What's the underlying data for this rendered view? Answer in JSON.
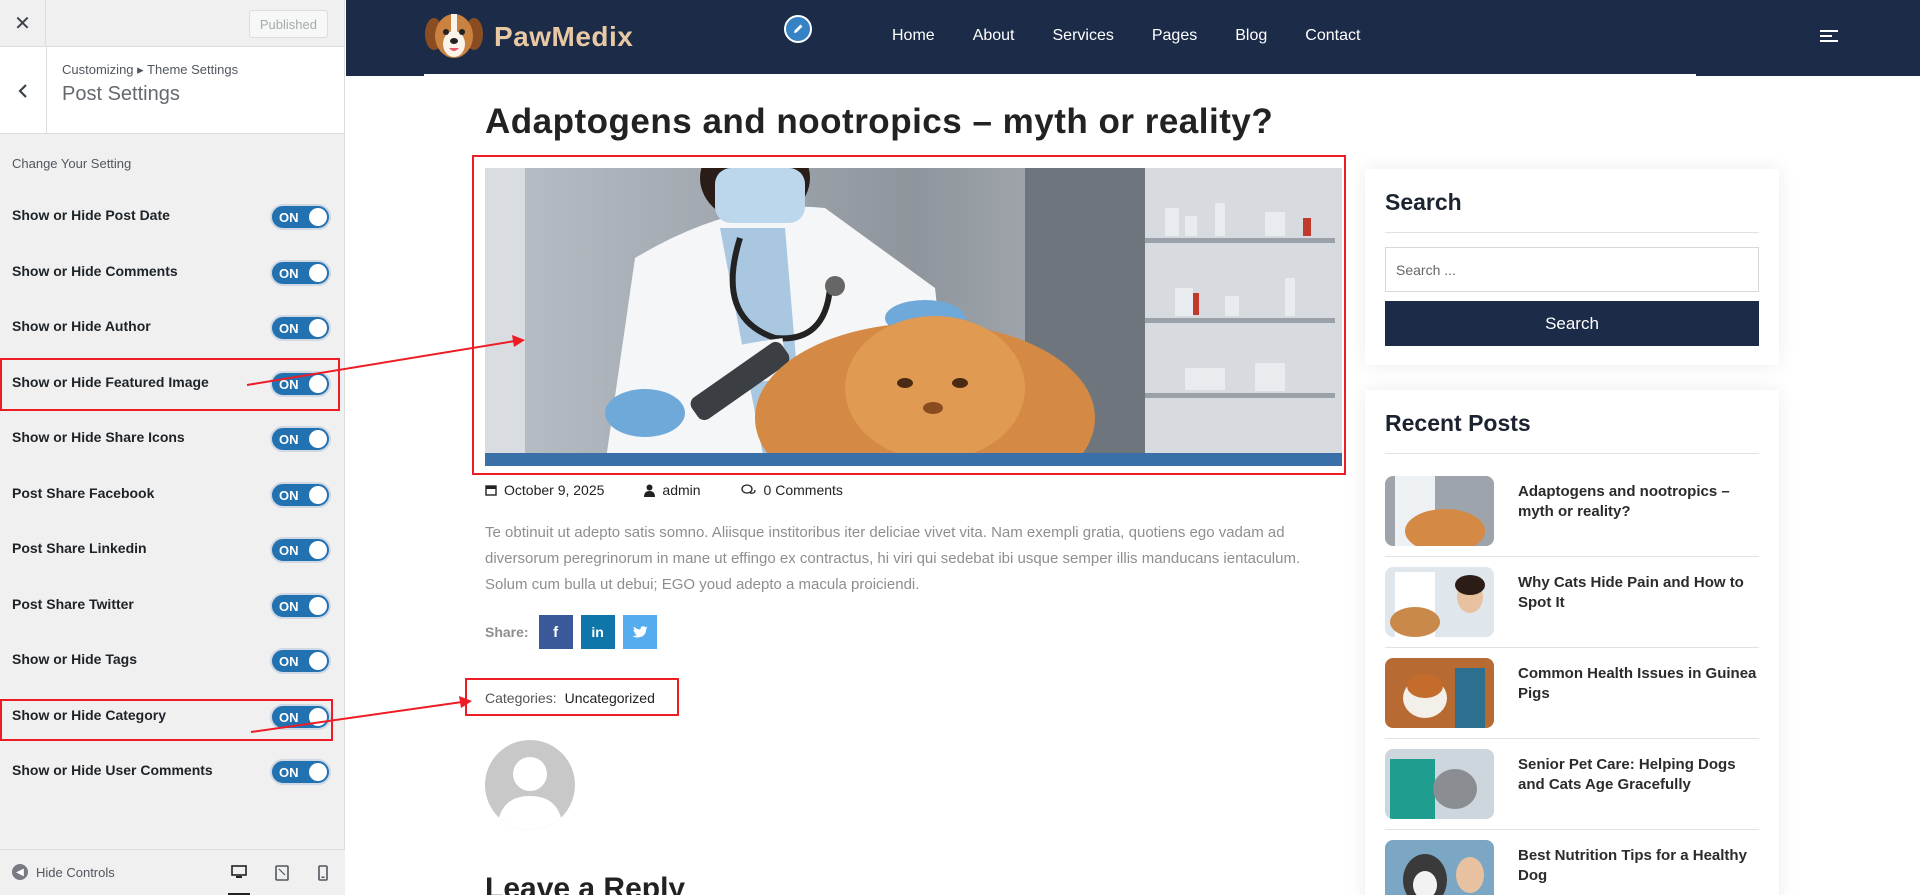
{
  "customizer": {
    "close_icon": "close-icon",
    "published_label": "Published",
    "breadcrumb": "Customizing ▸ Theme Settings",
    "section_title": "Post Settings",
    "subtitle": "Change Your Setting",
    "on_label": "ON",
    "settings": [
      {
        "label": "Show or Hide Post Date",
        "state": "ON"
      },
      {
        "label": "Show or Hide Comments",
        "state": "ON"
      },
      {
        "label": "Show or Hide Author",
        "state": "ON"
      },
      {
        "label": "Show or Hide Featured Image",
        "state": "ON"
      },
      {
        "label": "Show or Hide Share Icons",
        "state": "ON"
      },
      {
        "label": "Post Share Facebook",
        "state": "ON"
      },
      {
        "label": "Post Share Linkedin",
        "state": "ON"
      },
      {
        "label": "Post Share Twitter",
        "state": "ON"
      },
      {
        "label": "Show or Hide Tags",
        "state": "ON"
      },
      {
        "label": "Show or Hide Category",
        "state": "ON"
      },
      {
        "label": "Show or Hide User Comments",
        "state": "ON"
      }
    ],
    "hide_controls": "Hide Controls"
  },
  "site": {
    "brand": "PawMedix",
    "menu": [
      "Home",
      "About",
      "Services",
      "Pages",
      "Blog",
      "Contact"
    ],
    "post": {
      "title": "Adaptogens and nootropics – myth or reality?",
      "date": "October 9, 2025",
      "author": "admin",
      "comments": "0 Comments",
      "excerpt": "Te obtinuit ut adepto satis somno. Aliisque institoribus iter deliciae vivet vita. Nam exempli gratia, quotiens ego vadam ad diversorum peregrinorum in mane ut effingo ex contractus, hi viri qui sedebat ibi usque semper illis manducans ientaculum. Solum cum bulla ut debui; EGO youd adepto a macula proiciendi.",
      "share_label": "Share:",
      "categories_label": "Categories:",
      "category": "Uncategorized",
      "reply_heading": "Leave a Reply"
    },
    "search_widget": {
      "title": "Search",
      "placeholder": "Search ...",
      "button": "Search"
    },
    "recent_posts": {
      "title": "Recent Posts",
      "items": [
        "Adaptogens and nootropics – myth or reality?",
        "Why Cats Hide Pain and How to Spot It",
        "Common Health Issues in Guinea Pigs",
        "Senior Pet Care: Helping Dogs and Cats Age Gracefully",
        "Best Nutrition Tips for a Healthy Dog"
      ]
    },
    "colors": {
      "nav_bg": "#1c2b48",
      "annotation_red": "#ee1c25",
      "toggle_blue": "#2271b1",
      "facebook": "#3b5998",
      "linkedin": "#0e76a8",
      "twitter": "#55acee"
    }
  }
}
